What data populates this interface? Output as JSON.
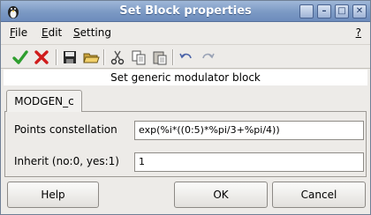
{
  "window": {
    "title": "Set Block properties"
  },
  "title_buttons": {
    "restore": "□",
    "minimize": "–",
    "maximize": "□",
    "close": "✕"
  },
  "menu": {
    "file": "File",
    "edit": "Edit",
    "setting": "Setting",
    "help": "?"
  },
  "toolbar_icons": [
    "ok-icon",
    "cancel-icon",
    "save-icon",
    "open-icon",
    "cut-icon",
    "copy-icon",
    "paste-icon",
    "undo-icon",
    "redo-icon"
  ],
  "banner": "Set generic modulator block",
  "tab": {
    "label": "MODGEN_c"
  },
  "fields": [
    {
      "label": "Points constellation",
      "value": "exp(%i*((0:5)*%pi/3+%pi/4))"
    },
    {
      "label": "Inherit (no:0, yes:1)",
      "value": "1"
    }
  ],
  "buttons": {
    "help": "Help",
    "ok": "OK",
    "cancel": "Cancel"
  },
  "colors": {
    "titlebar": "#7b99c4",
    "check_green": "#2f9e2f",
    "x_red": "#d01c1c"
  }
}
